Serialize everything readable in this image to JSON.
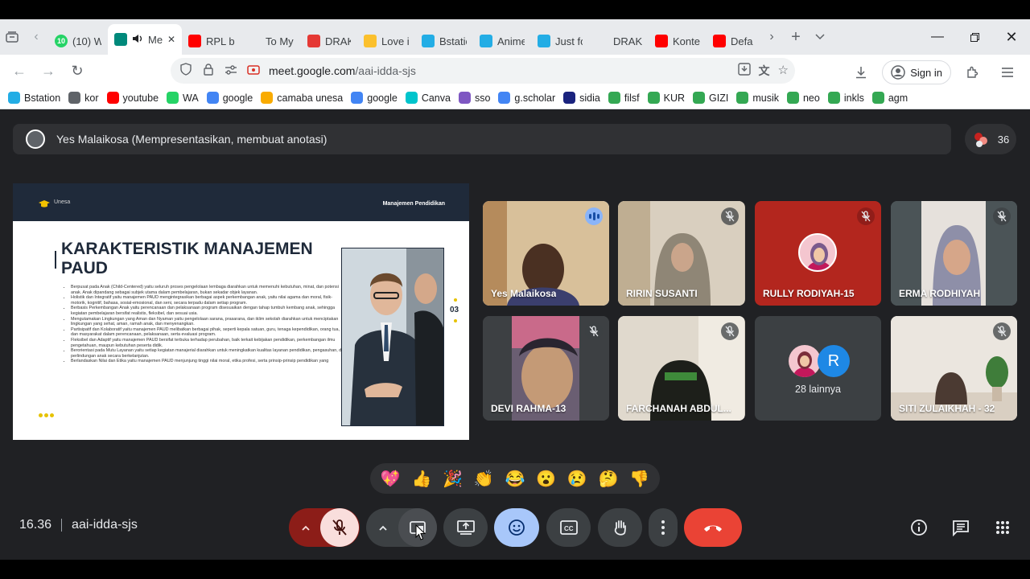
{
  "browser": {
    "tabs": [
      {
        "label": "(10) W",
        "icon": "whatsapp-icon",
        "color": "#25d366",
        "badge": "10"
      },
      {
        "label": "Mee",
        "icon": "meet-icon",
        "color": "#00897b",
        "active": true
      },
      {
        "label": "RPL ba",
        "icon": "youtube-icon",
        "color": "#ff0000"
      },
      {
        "label": "To My Belo",
        "icon": "page-icon",
        "color": "#ffffff"
      },
      {
        "label": "DRAKO",
        "icon": "drakor-icon",
        "color": "#e53935"
      },
      {
        "label": "Love i",
        "icon": "circle-play-icon",
        "color": "#fbc02d"
      },
      {
        "label": "Bstatio",
        "icon": "bstation-icon",
        "color": "#23ade5"
      },
      {
        "label": "Anime",
        "icon": "bstation-icon",
        "color": "#23ade5"
      },
      {
        "label": "Just fo",
        "icon": "bstation-icon",
        "color": "#23ade5"
      },
      {
        "label": "DRAKORIN",
        "icon": "page-icon",
        "color": "#ffffff"
      },
      {
        "label": "Konter",
        "icon": "youtube-icon",
        "color": "#ff0000"
      },
      {
        "label": "Defau",
        "icon": "youtube-icon",
        "color": "#ff0000"
      }
    ],
    "url_host": "meet.google.com",
    "url_path": "/aai-idda-sjs",
    "signin_label": "Sign in"
  },
  "bookmarks": [
    {
      "label": "Bstation",
      "color": "#23ade5"
    },
    {
      "label": "kor",
      "color": "#5f6368"
    },
    {
      "label": "youtube",
      "color": "#ff0000"
    },
    {
      "label": "WA",
      "color": "#25d366"
    },
    {
      "label": "google",
      "color": "#4285f4"
    },
    {
      "label": "camaba unesa",
      "color": "#f9ab00"
    },
    {
      "label": "google",
      "color": "#4285f4"
    },
    {
      "label": "Canva",
      "color": "#00c4cc"
    },
    {
      "label": "sso",
      "color": "#7e57c2"
    },
    {
      "label": "g.scholar",
      "color": "#4285f4"
    },
    {
      "label": "sidia",
      "color": "#1a237e"
    },
    {
      "label": "filsf",
      "color": "#34a853"
    },
    {
      "label": "KUR",
      "color": "#34a853"
    },
    {
      "label": "GIZI",
      "color": "#34a853"
    },
    {
      "label": "musik",
      "color": "#34a853"
    },
    {
      "label": "neo",
      "color": "#34a853"
    },
    {
      "label": "inkls",
      "color": "#34a853"
    },
    {
      "label": "agm",
      "color": "#34a853"
    }
  ],
  "meeting": {
    "presenter_text": "Yes Malaikosa (Mempresentasikan, membuat anotasi)",
    "participant_count": "36",
    "time": "16.36",
    "code": "aai-idda-sjs"
  },
  "slide": {
    "brand": "Unesa",
    "course": "Manajemen Pendidikan",
    "title": "KARAKTERISTIK MANAJEMEN PAUD",
    "page": "03",
    "bullets": [
      "Berpusat pada Anak (Child-Centered) yaitu seluruh proses pengelolaan lembaga diarahkan untuk memenuhi kebutuhan, minat, dan potensi anak. Anak dipandang sebagai subjek utama dalam pembelajaran, bukan sekadar objek layanan.",
      "Holistik dan Integratif yaitu manajemen PAUD mengintegrasikan berbagai aspek perkembangan anak, yaitu nilai agama dan moral, fisik-motorik, kognitif, bahasa, sosial-emosional, dan seni, secara terpadu dalam setiap program.",
      "Berbasis Perkembangan Anak yaitu perencanaan dan pelaksanaan program disesuaikan dengan tahap tumbuh kembang anak, sehingga kegiatan pembelajaran bersifat realistis, fleksibel, dan sesuai usia.",
      "Mengutamakan Lingkungan yang Aman dan Nyaman yaitu pengelolaan sarana, prasarana, dan iklim sekolah diarahkan untuk menciptakan lingkungan yang sehat, aman, ramah anak, dan menyenangkan.",
      "Partisipatif dan Kolaboratif yaitu manajemen PAUD melibatkan berbagai pihak, seperti kepala satuan, guru, tenaga kependidikan, orang tua, dan masyarakat dalam perencanaan, pelaksanaan, serta evaluasi program.",
      "Fleksibel dan Adaptif yaitu manajemen PAUD bersifat terbuka terhadap perubahan, baik terkait kebijakan pendidikan, perkembangan ilmu pengetahuan, maupun kebutuhan peserta didik.",
      "Berorientasi pada Mutu Layanan yaitu setiap kegiatan manajerial diarahkan untuk meningkatkan kualitas layanan pendidikan, pengasuhan, dan perlindungan anak secara berkelanjutan.",
      "Berlandaskan Nilai dan Etika yaitu manajemen PAUD menjunjung tinggi nilai moral, etika profesi, serta prinsip-prinsip pendidikan yang"
    ]
  },
  "participants": [
    {
      "name": "Yes Malaikosa",
      "state": "speaking",
      "bg": "#c9a77e"
    },
    {
      "name": "RIRIN SUSANTI",
      "state": "muted",
      "bg": "#cfc3b2"
    },
    {
      "name": "RULLY RODIYAH-15",
      "state": "muted-red",
      "bg": "#b3261e"
    },
    {
      "name": "ERMA RODHIYAH",
      "state": "muted",
      "bg": "#5e6a6d"
    },
    {
      "name": "DEVI RAHMA-13",
      "state": "muted",
      "bg": "#3d4043"
    },
    {
      "name": "FARCHANAH ABDUL...",
      "state": "muted",
      "bg": "#d9d2c6"
    },
    {
      "name": "28 lainnya",
      "state": "others",
      "bg": "#3c4043",
      "avatar_letter": "R"
    },
    {
      "name": "SITI ZULAIKHAH - 32",
      "state": "muted",
      "bg": "#e7e1da"
    }
  ],
  "reactions": [
    "💖",
    "👍",
    "🎉",
    "👏",
    "😂",
    "😮",
    "😢",
    "🤔",
    "👎"
  ]
}
